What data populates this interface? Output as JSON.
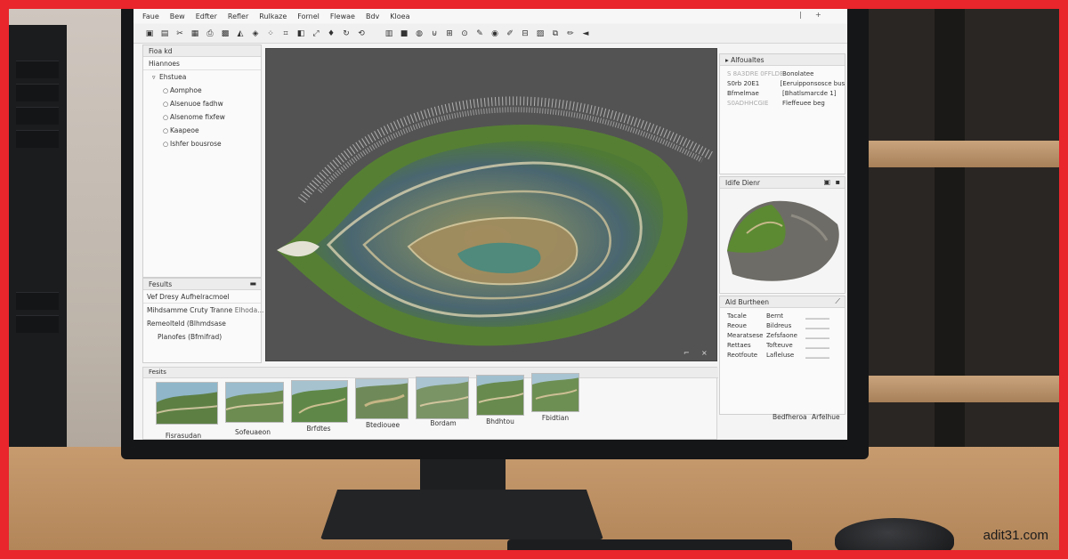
{
  "menubar": {
    "items": [
      "Faue",
      "Bew",
      "Edfter",
      "Refler",
      "Rulkaze",
      "Fornel",
      "Flewae",
      "Bdv",
      "Kloea"
    ],
    "window_controls": [
      "|",
      "+"
    ]
  },
  "toolbar": {
    "groups": [
      [
        "save",
        "page",
        "cut",
        "frame",
        "print",
        "grid",
        "shape",
        "shape",
        "dots",
        "crop",
        "shape",
        "expand",
        "drop",
        "redo",
        "reload"
      ],
      [
        "layer",
        "box",
        "globe",
        "magnet",
        "grid",
        "lasso",
        "pen",
        "camera",
        "pen",
        "grid",
        "image",
        "layers",
        "pen",
        "back"
      ]
    ]
  },
  "left_panel": {
    "title": "Fioa kd",
    "subtitle": "Hiannoes",
    "tree": [
      {
        "label": "Ehstuea",
        "indent": 1,
        "icon": "t"
      },
      {
        "label": "Aomphoe",
        "indent": 2,
        "icon": "c"
      },
      {
        "label": "Alsenuoe fadhw",
        "indent": 2,
        "icon": "c"
      },
      {
        "label": "Alsenome fixfew",
        "indent": 2,
        "icon": "c"
      },
      {
        "label": "Kaapeoe",
        "indent": 2,
        "icon": "c"
      },
      {
        "label": "Ishfer bousrose",
        "indent": 2,
        "icon": "c"
      }
    ]
  },
  "results_panel": {
    "title": "Fesults",
    "rows": [
      {
        "label": "Vef Dresy Aufhelracmoel"
      },
      {
        "label": "Mihdsamme Cruty Tranne",
        "value": "Elhoda..."
      },
      {
        "label": "Remeolteld (Blhmdsase"
      },
      {
        "label": "Planofes (Bfmifrad)"
      }
    ]
  },
  "right_top_panel": {
    "title": "Alfoualtes",
    "rows": [
      {
        "col1": "S 8A3DRE 0FFLDE",
        "col2": "Bonolatee"
      },
      {
        "col1": "S0rb 20E1",
        "col2": "[Eeruipponsosce bus]"
      },
      {
        "col1": "Bfmelmae",
        "col2": "[Bhatlsmarcde 1]"
      },
      {
        "col1": "S0ADHHCGIE",
        "col2": "Fleffeuee beg"
      }
    ]
  },
  "preview_panel": {
    "title": "Idife Dienr"
  },
  "properties_panel": {
    "title": "Ald Burtheen",
    "rows": [
      {
        "col1": "Tacale",
        "col2": "Bernt"
      },
      {
        "col1": "Reoue",
        "col2": "Bildreus"
      },
      {
        "col1": "Mearatsese",
        "col2": "Zefsfaone"
      },
      {
        "col1": "Rettaes",
        "col2": "Tofteuve"
      },
      {
        "col1": "Reotfoute",
        "col2": "Lafleluse"
      }
    ]
  },
  "gallery": {
    "title": "Fesits",
    "items": [
      {
        "label": "Fisrasudan"
      },
      {
        "label": "Sofeuaeon"
      },
      {
        "label": "Brfdtes"
      },
      {
        "label": "Btediouee"
      },
      {
        "label": "Bordam"
      },
      {
        "label": "Bhdhtou"
      },
      {
        "label": "Fbidtian"
      }
    ]
  },
  "status_bar": {
    "left": "Bedfheroa",
    "right": "Arfelhue"
  },
  "watermark": "adit31.com",
  "colors": {
    "frame": "#e8262c",
    "viewport_bg": "#535353",
    "panel_bg": "#fafafa",
    "terrain_green": "#5f8a3a"
  }
}
